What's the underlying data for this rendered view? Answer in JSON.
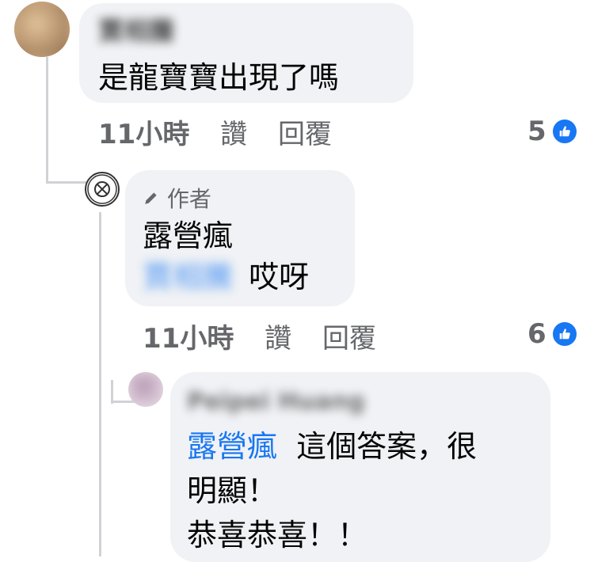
{
  "comments": [
    {
      "author": "賈相騰",
      "text": "是龍寶寶出現了嗎",
      "time": "11小時",
      "like_label": "讚",
      "reply_label": "回覆",
      "reactions": "5",
      "avatar_color": "#c9a67f"
    },
    {
      "author_badge": "作者",
      "author": "露營瘋",
      "mention": "賈相騰",
      "text": "哎呀",
      "time": "11小時",
      "like_label": "讚",
      "reply_label": "回覆",
      "reactions": "6"
    },
    {
      "author": "Peipei Huang",
      "mention": "露營瘋",
      "text_line1": "這個答案，很",
      "text_line2": "明顯！",
      "text_line3": "恭喜恭喜！！"
    }
  ],
  "colors": {
    "mention": "#1877f2",
    "bubble": "#f0f2f5",
    "meta": "#65676b"
  },
  "icons": [
    "like-reaction-icon",
    "pencil-icon"
  ]
}
